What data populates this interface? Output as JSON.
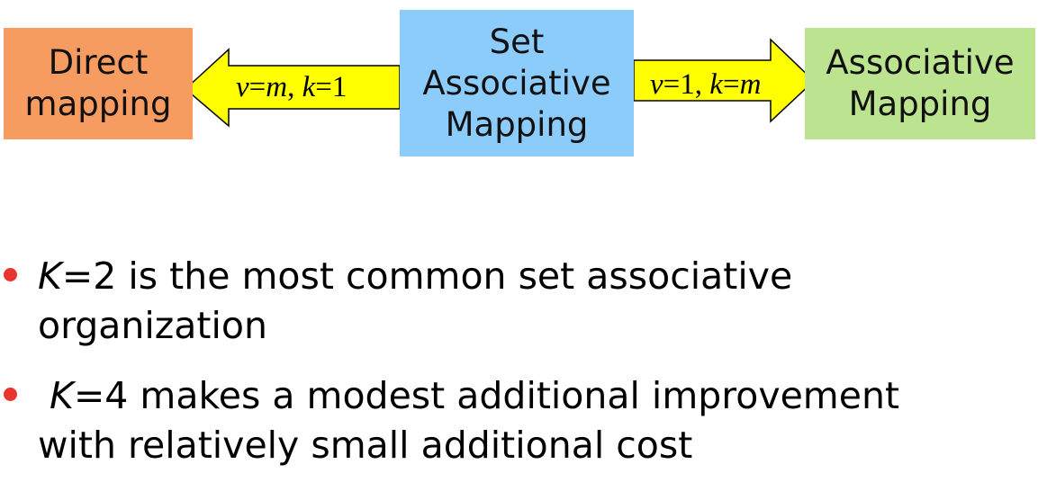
{
  "boxes": {
    "direct": {
      "line1": "Direct",
      "line2": "mapping",
      "color": "#f79c61"
    },
    "set": {
      "line1": "Set",
      "line2": "Associative",
      "line3": "Mapping",
      "color": "#8cccfa"
    },
    "associative": {
      "line1": "Associative",
      "line2": "Mapping",
      "color": "#bce38f"
    }
  },
  "arrows": {
    "left": {
      "var1": "v",
      "eq1": "=",
      "var2": "m",
      "sep": ", ",
      "var3": "k",
      "eq2": "=",
      "num": "1",
      "color": "#ffff00"
    },
    "right": {
      "var1": "v",
      "eq1": "=",
      "num": "1",
      "sep": ", ",
      "var2": "k",
      "eq2": "=",
      "var3": "m",
      "color": "#ffff00"
    }
  },
  "bullets": [
    {
      "lead": "",
      "var": "K",
      "rest": "=2 is the most common set associative",
      "line2": "organization"
    },
    {
      "lead": " ",
      "var": "K",
      "rest": "=4 makes a modest additional improvement",
      "line2": "with relatively small additional cost"
    }
  ],
  "colors": {
    "bullet": "#e8352d",
    "arrow_fill": "#ffff00",
    "arrow_stroke": "#000000"
  }
}
